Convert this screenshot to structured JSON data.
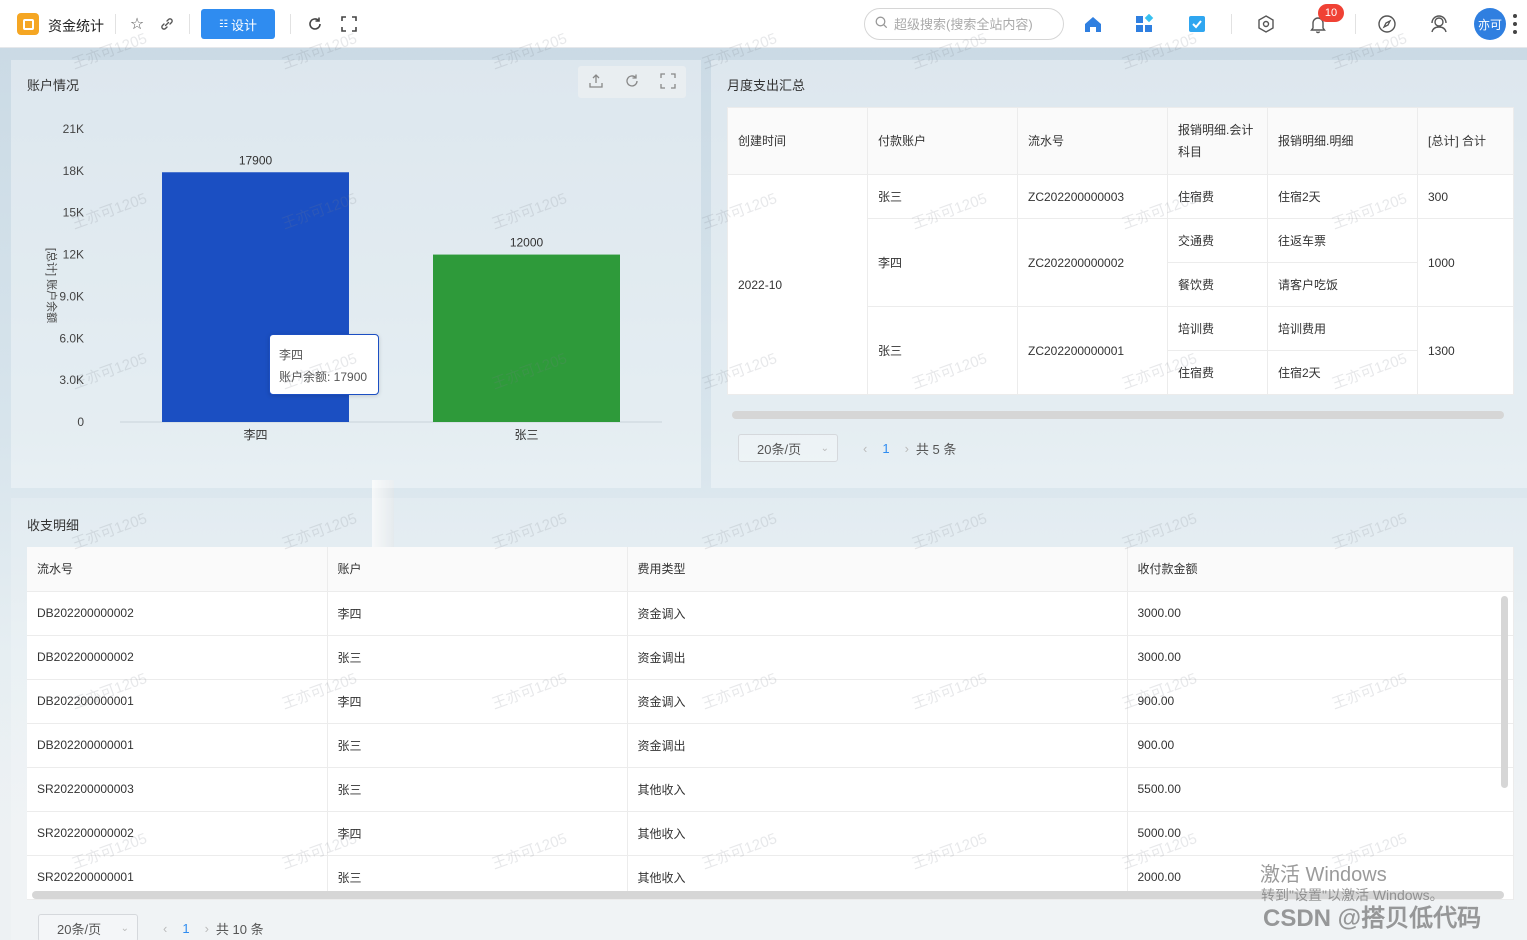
{
  "topbar": {
    "app_title": "资金统计",
    "design_label": "设计",
    "search_placeholder": "超级搜索(搜索全站内容)",
    "notification_count": "10",
    "avatar_text": "亦可"
  },
  "account_panel": {
    "title": "账户情况"
  },
  "chart_data": {
    "type": "bar",
    "categories": [
      "李四",
      "张三"
    ],
    "values": [
      17900,
      12000
    ],
    "colors": [
      "#1b4fc2",
      "#2e9a3a"
    ],
    "ylabel": "[总计] 账户余额",
    "ylim": [
      0,
      21000
    ],
    "y_ticks": [
      "0",
      "3.0K",
      "6.0K",
      "9.0K",
      "12K",
      "15K",
      "18K",
      "21K"
    ],
    "y_tick_values": [
      0,
      3000,
      6000,
      9000,
      12000,
      15000,
      18000,
      21000
    ],
    "data_labels": [
      "17900",
      "12000"
    ],
    "tooltip": {
      "category": "李四",
      "label": "账户余额: 17900"
    }
  },
  "monthly_panel": {
    "title": "月度支出汇总",
    "headers": [
      "创建时间",
      "付款账户",
      "流水号",
      "报销明细.会计科目",
      "报销明细.明细",
      "[总计] 合计"
    ],
    "month": "2022-10",
    "groups": [
      {
        "account": "张三",
        "serial": "ZC202200000003",
        "items": [
          {
            "subject": "住宿费",
            "detail": "住宿2天"
          }
        ],
        "total": "300"
      },
      {
        "account": "李四",
        "serial": "ZC202200000002",
        "items": [
          {
            "subject": "交通费",
            "detail": "往返车票"
          },
          {
            "subject": "餐饮费",
            "detail": "请客户吃饭"
          }
        ],
        "total": "1000"
      },
      {
        "account": "张三",
        "serial": "ZC202200000001",
        "items": [
          {
            "subject": "培训费",
            "detail": "培训费用"
          },
          {
            "subject": "住宿费",
            "detail": "住宿2天"
          }
        ],
        "total": "1300"
      }
    ],
    "pager": {
      "page_size": "20条/页",
      "current": "1",
      "total": "共 5 条"
    }
  },
  "detail_panel": {
    "title": "收支明细",
    "headers": [
      "流水号",
      "账户",
      "费用类型",
      "收付款金额"
    ],
    "rows": [
      [
        "DB202200000002",
        "李四",
        "资金调入",
        "3000.00"
      ],
      [
        "DB202200000002",
        "张三",
        "资金调出",
        "3000.00"
      ],
      [
        "DB202200000001",
        "李四",
        "资金调入",
        "900.00"
      ],
      [
        "DB202200000001",
        "张三",
        "资金调出",
        "900.00"
      ],
      [
        "SR202200000003",
        "张三",
        "其他收入",
        "5500.00"
      ],
      [
        "SR202200000002",
        "李四",
        "其他收入",
        "5000.00"
      ],
      [
        "SR202200000001",
        "张三",
        "其他收入",
        "2000.00"
      ]
    ],
    "pager": {
      "page_size": "20条/页",
      "current": "1",
      "total": "共 10 条"
    }
  },
  "watermark": "王亦可1205",
  "overlay": {
    "windows_title": "激活 Windows",
    "windows_sub": "转到\"设置\"以激活 Windows。",
    "csdn": "CSDN @搭贝低代码"
  }
}
